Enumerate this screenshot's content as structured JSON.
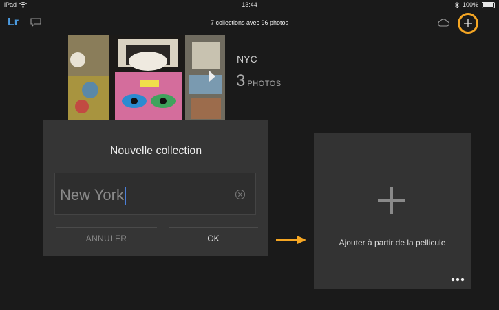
{
  "status_bar": {
    "device": "iPad",
    "time": "13:44",
    "battery": "100%"
  },
  "toolbar": {
    "logo": "Lr",
    "title": "7 collections avec 96 photos"
  },
  "collection": {
    "name": "NYC",
    "count": "3",
    "count_unit": "PHOTOS"
  },
  "dialog": {
    "title": "Nouvelle collection",
    "input_value": "New York",
    "cancel_label": "ANNULER",
    "ok_label": "OK"
  },
  "add_tile": {
    "label": "Ajouter à partir de la pellicule"
  },
  "colors": {
    "accent": "#f5a623",
    "logo": "#4b9be0",
    "background": "#1a1a1a",
    "dialog": "#353535",
    "tile": "#333333"
  },
  "icons": [
    "wifi-icon",
    "chat-icon",
    "cloud-icon",
    "plus-icon",
    "clear-icon",
    "arrow-right-icon",
    "more-icon",
    "bluetooth-icon",
    "battery-icon"
  ]
}
